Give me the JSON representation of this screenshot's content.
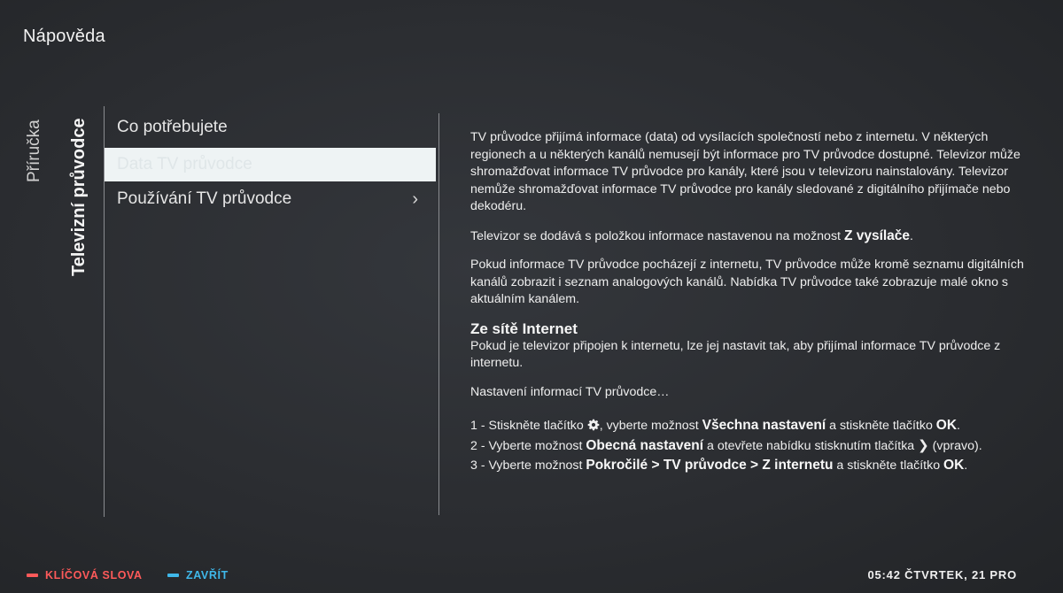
{
  "header": {
    "title": "Nápověda"
  },
  "side_tabs": [
    {
      "label": "Příručka"
    },
    {
      "label": "Televizní průvodce"
    }
  ],
  "menu": {
    "items": [
      {
        "label": "Co potřebujete"
      },
      {
        "label": "Data TV průvodce",
        "selected": true
      },
      {
        "label": "Používání TV průvodce",
        "has_submenu": true
      }
    ]
  },
  "content": {
    "para1": "TV průvodce přijímá informace (data) od vysílacích společností nebo z internetu. V některých regionech a u některých kanálů nemusejí být informace pro TV průvodce dostupné. Televizor může shromažďovat informace TV průvodce pro kanály, které jsou v televizoru nainstalovány. Televizor nemůže shromažďovat informace TV průvodce pro kanály sledované z digitálního přijímače nebo dekodéru.",
    "para2_text": "Televizor se dodává s položkou informace nastavenou na možnost ",
    "para2_bold": "Z vysílače",
    "para2_end": ".",
    "para3": "Pokud informace TV průvodce pocházejí z internetu, TV průvodce může kromě seznamu digitálních kanálů zobrazit i seznam analogových kanálů. Nabídka TV průvodce také zobrazuje malé okno s aktuálním kanálem.",
    "heading": "Ze sítě Internet",
    "para4": "Pokud je televizor připojen k internetu, lze jej nastavit tak, aby přijímal informace TV průvodce z internetu.",
    "para5": "Nastavení informací TV průvodce…",
    "steps": [
      {
        "a": "1 - Stiskněte tlačítko ",
        "icon": "gear-icon",
        "b": ", vyberte možnost ",
        "bold": "Všechna nastavení",
        "c": " a stiskněte tlačítko ",
        "bold2": "OK",
        "d": "."
      },
      {
        "a": "2 - Vyberte možnost ",
        "bold": "Obecná nastavení",
        "b": " a otevřete nabídku stisknutím tlačítka ",
        "icon": "chevron-right-icon",
        "c": " (vpravo)."
      },
      {
        "a": "3 - Vyberte možnost ",
        "bold": "Pokročilé > TV průvodce > Z internetu",
        "b": " a stiskněte tlačítko ",
        "bold2": "OK",
        "c": "."
      }
    ]
  },
  "footer": {
    "red_label": "KLÍČOVÁ SLOVA",
    "blue_label": "ZAVŘÍT",
    "clock": "05:42 ČTVRTEK, 21 PRO"
  },
  "colors": {
    "background": "#2a2c30",
    "selection": "#eef3f4",
    "footer_red": "#ff5a5a",
    "footer_blue": "#3fb8ea"
  }
}
